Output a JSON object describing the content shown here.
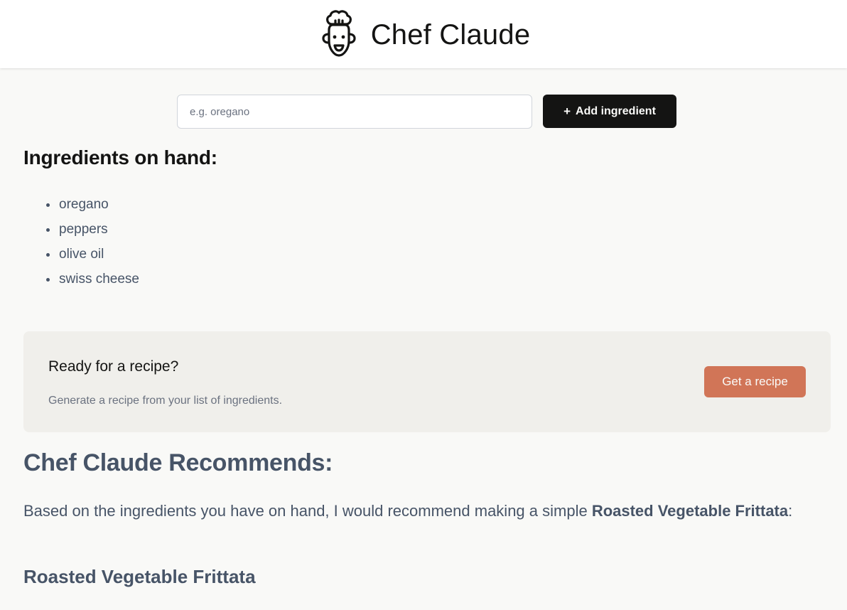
{
  "header": {
    "title": "Chef Claude",
    "logo_icon": "chef-hat-face-icon"
  },
  "form": {
    "input_placeholder": "e.g. oregano",
    "input_value": "",
    "add_button_icon": "+",
    "add_button_label": "Add ingredient"
  },
  "ingredients": {
    "heading": "Ingredients on hand:",
    "items": [
      "oregano",
      "peppers",
      "olive oil",
      "swiss cheese"
    ]
  },
  "cta": {
    "title": "Ready for a recipe?",
    "description": "Generate a recipe from your list of ingredients.",
    "button_label": "Get a recipe"
  },
  "recommendation": {
    "heading": "Chef Claude Recommends:",
    "intro_text": "Based on the ingredients you have on hand, I would recommend making a simple ",
    "dish_name": "Roasted Vegetable Frittata",
    "intro_suffix": ":",
    "recipe_title": "Roasted Vegetable Frittata"
  },
  "colors": {
    "accent": "#d17557",
    "dark_button": "#141413",
    "body_text": "#475467",
    "page_bg": "#f9f9f7",
    "card_bg": "#f0efeb"
  }
}
